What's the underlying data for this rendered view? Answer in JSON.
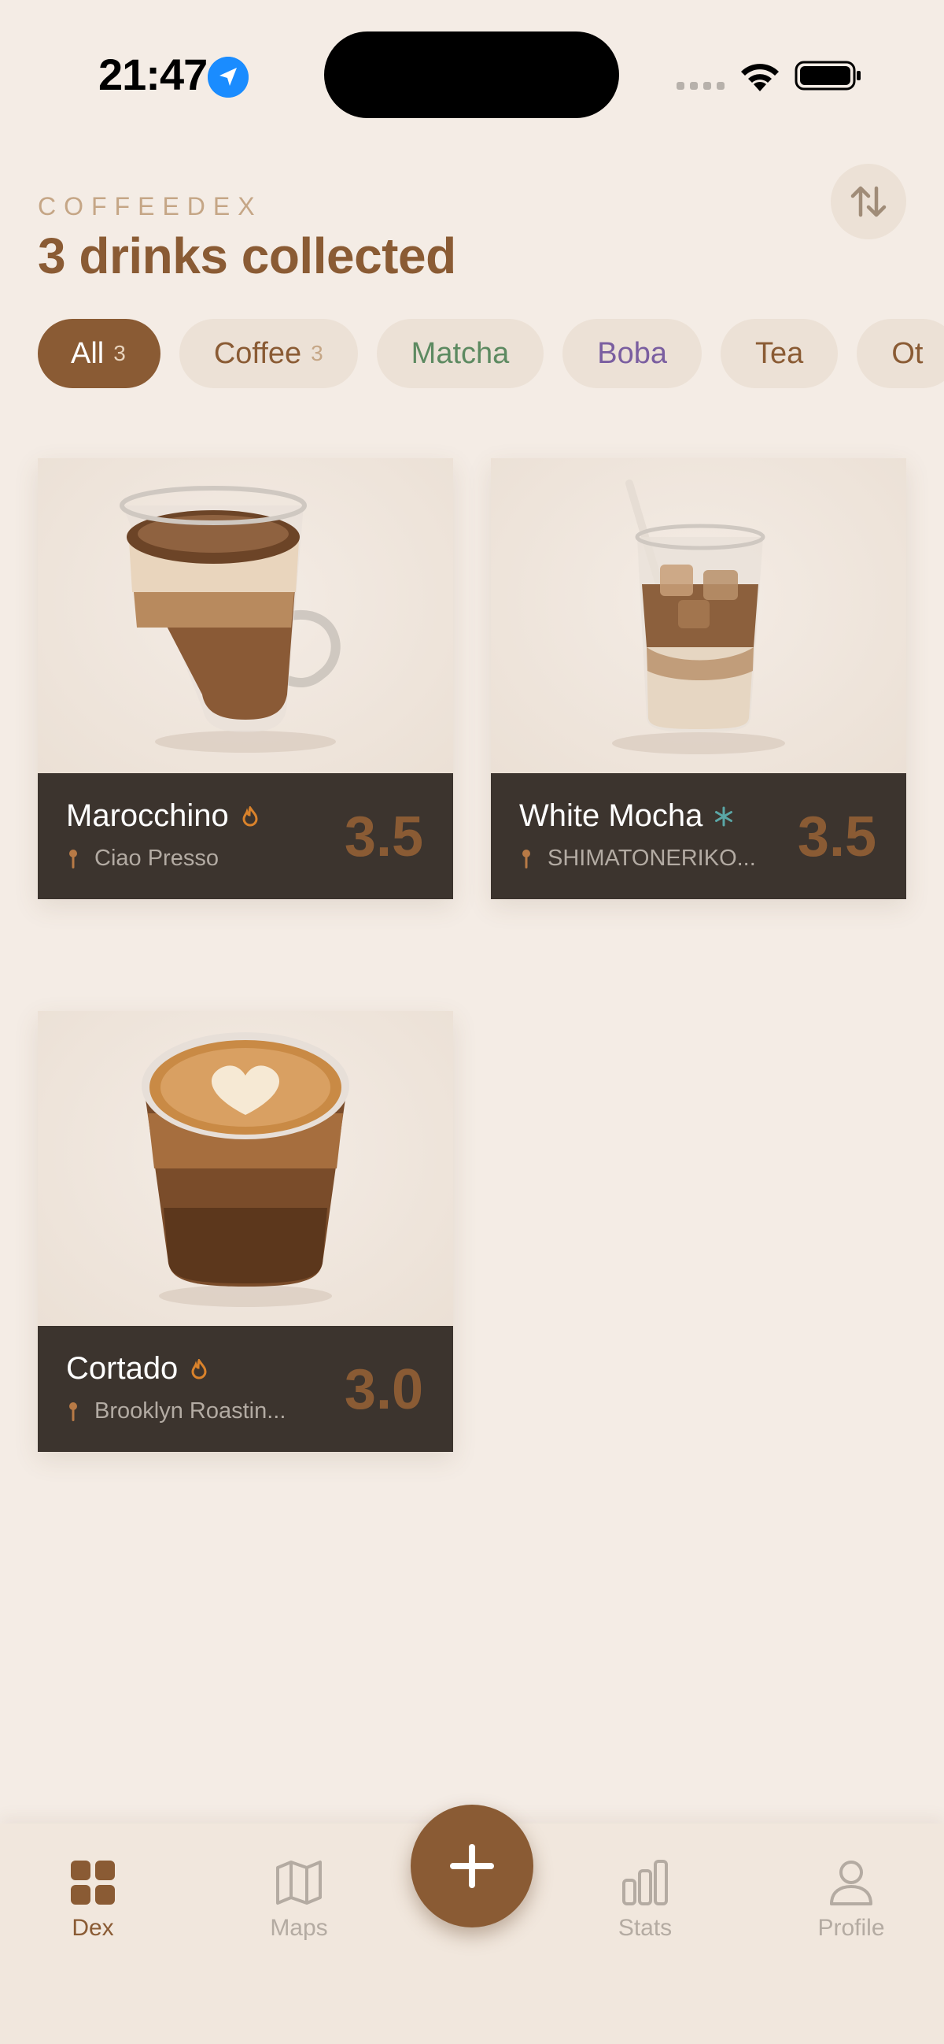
{
  "status_bar": {
    "time": "21:47"
  },
  "header": {
    "brand": "COFFEEDEX",
    "title": "3 drinks collected"
  },
  "filters": [
    {
      "label": "All",
      "count": "3"
    },
    {
      "label": "Coffee",
      "count": "3"
    },
    {
      "label": "Matcha",
      "count": ""
    },
    {
      "label": "Boba",
      "count": ""
    },
    {
      "label": "Tea",
      "count": ""
    },
    {
      "label": "Ot",
      "count": ""
    }
  ],
  "drinks": [
    {
      "name": "Marocchino",
      "temperature_icon": "flame-icon",
      "place": "Ciao Presso",
      "rating": "3.5"
    },
    {
      "name": "White Mocha",
      "temperature_icon": "snowflake-icon",
      "place": "SHIMATONERIKO...",
      "rating": "3.5"
    },
    {
      "name": "Cortado",
      "temperature_icon": "flame-icon",
      "place": "Brooklyn Roastin...",
      "rating": "3.0"
    }
  ],
  "tabs": [
    {
      "label": "Dex",
      "icon": "grid-icon",
      "active": true
    },
    {
      "label": "Maps",
      "icon": "map-icon",
      "active": false
    },
    {
      "label": "Stats",
      "icon": "bar-chart-icon",
      "active": false
    },
    {
      "label": "Profile",
      "icon": "person-icon",
      "active": false
    }
  ],
  "colors": {
    "background": "#f4ece5",
    "accent": "#8a5b34",
    "card_footer": "#3c342e",
    "flame": "#d9822b",
    "snowflake": "#5aa6a6",
    "matcha": "#5d8a61",
    "boba": "#7a5ea0"
  }
}
